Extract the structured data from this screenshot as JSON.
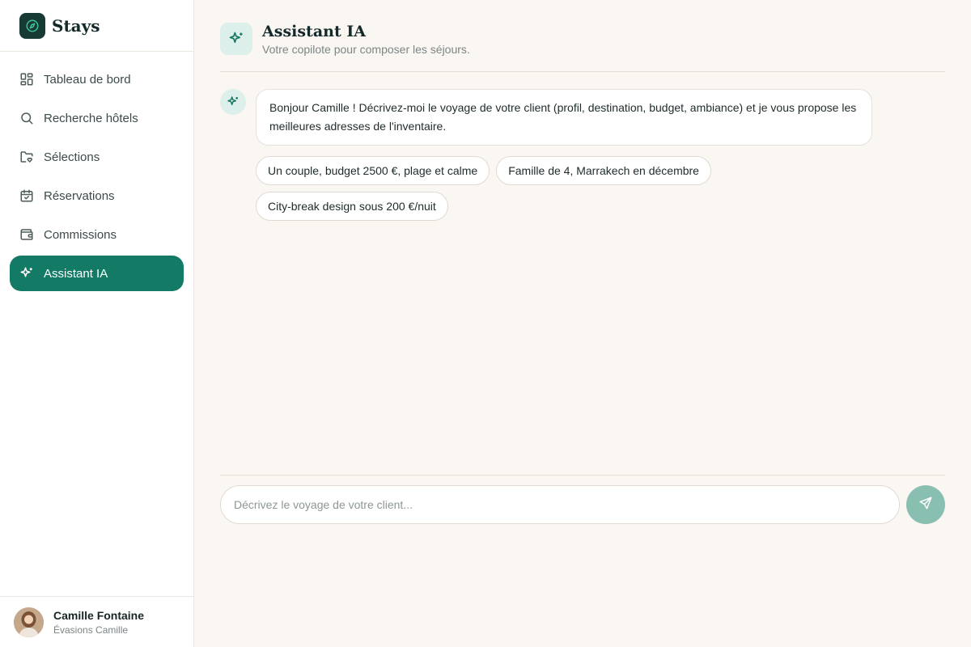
{
  "brand": {
    "name": "Stays",
    "logo_icon": "compass-icon",
    "logo_color": "#163a34"
  },
  "sidebar": {
    "items": [
      {
        "label": "Tableau de bord",
        "icon": "dashboard-grid-icon",
        "active": false
      },
      {
        "label": "Recherche hôtels",
        "icon": "search-icon",
        "active": false
      },
      {
        "label": "Sélections",
        "icon": "folder-heart-icon",
        "active": false
      },
      {
        "label": "Réservations",
        "icon": "calendar-check-icon",
        "active": false
      },
      {
        "label": "Commissions",
        "icon": "wallet-icon",
        "active": false
      },
      {
        "label": "Assistant IA",
        "icon": "sparkles-icon",
        "active": true
      }
    ],
    "active_color": "#137a65"
  },
  "user": {
    "name": "Camille Fontaine",
    "organization": "Évasions Camille"
  },
  "header": {
    "title": "Assistant IA",
    "subtitle": "Votre copilote pour composer les séjours.",
    "icon": "sparkles-icon"
  },
  "chat": {
    "messages": [
      {
        "role": "assistant",
        "text": "Bonjour Camille ! Décrivez-moi le voyage de votre client (profil, destination, budget, ambiance) et je vous propose les meilleures adresses de l'inventaire."
      }
    ],
    "suggestions": [
      "Un couple, budget 2500 €, plage et calme",
      "Famille de 4, Marrakech en décembre",
      "City-break design sous 200 €/nuit"
    ]
  },
  "composer": {
    "placeholder": "Décrivez le voyage de votre client...",
    "value": "",
    "send_icon": "send-icon",
    "send_color": "#89bfb0"
  }
}
